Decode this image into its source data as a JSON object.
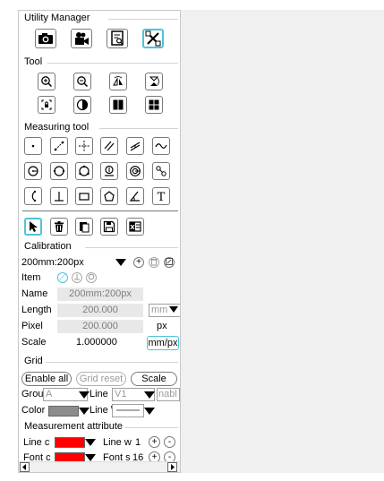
{
  "sections": {
    "utility": "Utility Manager",
    "tool": "Tool",
    "measuring": "Measuring tool",
    "calibration": "Calibration",
    "grid": "Grid",
    "attribute": "Measurement attribute"
  },
  "utility_buttons": [
    "camera-icon",
    "video-camera-icon",
    "report-icon",
    "tools-icon"
  ],
  "calibration": {
    "preset": "200mm:200px",
    "item_label": "Item",
    "name_label": "Name",
    "name_value": "200mm:200px",
    "length_label": "Length",
    "length_value": "200.000",
    "length_unit": "mm",
    "pixel_label": "Pixel",
    "pixel_value": "200.000",
    "pixel_unit": "px",
    "scale_label": "Scale",
    "scale_value": "1.000000",
    "scale_unit": "mm/px"
  },
  "grid": {
    "enable_all": "Enable all",
    "grid_reset": "Grid reset",
    "scale": "Scale",
    "group_label": "Grou|",
    "group_value": "A",
    "line_label": "Line",
    "line_value": "V1",
    "enable_label": "nabl",
    "color_label": "Color",
    "color_value": "#8c8c8c",
    "line_style_label": "Line \\"
  },
  "attribute": {
    "line_color_label": "Line c",
    "line_color": "#ff0000",
    "line_width_label": "Line w",
    "line_width_value": "1",
    "font_color_label": "Font c",
    "font_color": "#ff0000",
    "font_size_label": "Font s",
    "font_size_value": "16",
    "plus": "+",
    "minus": "-"
  },
  "colors": {
    "accent": "#4fc3d9",
    "panel_border": "#c8c8c8",
    "disabled_field": "#e8e8e8"
  }
}
